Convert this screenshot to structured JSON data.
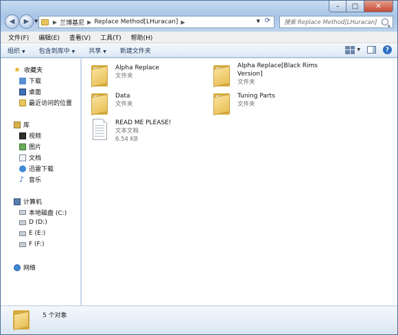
{
  "window": {
    "caption_buttons": {
      "minimize_icon": "minimize-icon",
      "maximize_icon": "maximize-icon",
      "close_icon": "close-icon"
    }
  },
  "address_bar": {
    "segments": [
      "兰博基尼",
      "Replace Method[LHuracan]"
    ],
    "search_placeholder": "搜索 Replace Method[LHuracan]"
  },
  "menu": {
    "items": [
      "文件(F)",
      "编辑(E)",
      "查看(V)",
      "工具(T)",
      "帮助(H)"
    ]
  },
  "toolbar": {
    "organize": "组织",
    "include_in_library": "包含到库中",
    "share": "共享",
    "new_folder": "新建文件夹"
  },
  "sidebar": {
    "favorites": {
      "label": "收藏夹",
      "items": [
        "下载",
        "桌面",
        "最近访问的位置"
      ]
    },
    "libraries": {
      "label": "库",
      "items": [
        "视频",
        "图片",
        "文档",
        "迅雷下载",
        "音乐"
      ]
    },
    "computer": {
      "label": "计算机",
      "items": [
        "本地磁盘 (C:)",
        "D (D:)",
        "E (E:)",
        "F (F:)"
      ]
    },
    "network": {
      "label": "网络"
    }
  },
  "files": [
    {
      "name": "Alpha Replace",
      "type": "文件夹",
      "icon": "folder-icon"
    },
    {
      "name": "Alpha Replace[Black Rims Version]",
      "name_line1": "Alpha Replace[Black Rims",
      "name_line2": "Version]",
      "type": "文件夹",
      "icon": "folder-icon"
    },
    {
      "name": "Data",
      "type": "文件夹",
      "icon": "folder-icon"
    },
    {
      "name": "Tuning Parts",
      "type": "文件夹",
      "icon": "folder-icon"
    },
    {
      "name": "READ ME PLEASE!",
      "type": "文本文档",
      "size": "6.54 KB",
      "icon": "text-file-icon"
    }
  ],
  "details": {
    "count": "5 个对象"
  }
}
